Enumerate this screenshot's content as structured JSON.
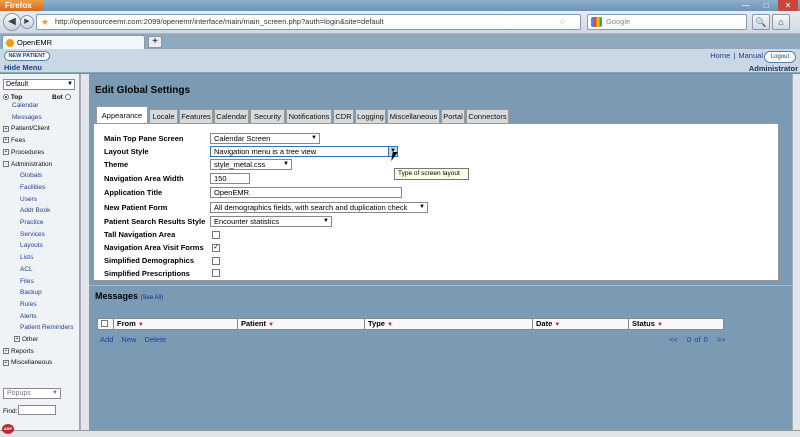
{
  "browser": {
    "app_name": "Firefox",
    "url": "http://opensourceemr.com:2099/openemr/interface/main/main_screen.php?auth=login&site=default",
    "search_placeholder": "Google",
    "tab_title": "OpenEMR",
    "new_tab": "+",
    "status_addon": "ABP"
  },
  "header": {
    "new_patient": "NEW PATIENT",
    "hide_menu": "Hide Menu",
    "home": "Home",
    "separator": "|",
    "manual": "Manual",
    "logout": "Logout",
    "user": "Administrator"
  },
  "sidebar": {
    "layout_select": "Default",
    "top_label": "Top",
    "bot_label": "Bot",
    "items": [
      {
        "label": "Calendar",
        "type": "sub"
      },
      {
        "label": "Messages",
        "type": "sub"
      },
      {
        "label": "Patient/Client",
        "type": "top"
      },
      {
        "label": "Fees",
        "type": "top"
      },
      {
        "label": "Procedures",
        "type": "top"
      },
      {
        "label": "Administration",
        "type": "top"
      },
      {
        "label": "Globals",
        "type": "sub2"
      },
      {
        "label": "Facilities",
        "type": "sub2"
      },
      {
        "label": "Users",
        "type": "sub2"
      },
      {
        "label": "Addr Book",
        "type": "sub2"
      },
      {
        "label": "Practice",
        "type": "sub2"
      },
      {
        "label": "Services",
        "type": "sub2"
      },
      {
        "label": "Layouts",
        "type": "sub2"
      },
      {
        "label": "Lists",
        "type": "sub2"
      },
      {
        "label": "ACL",
        "type": "sub2"
      },
      {
        "label": "Files",
        "type": "sub2"
      },
      {
        "label": "Backup",
        "type": "sub2"
      },
      {
        "label": "Rules",
        "type": "sub2"
      },
      {
        "label": "Alerts",
        "type": "sub2"
      },
      {
        "label": "Patient Reminders",
        "type": "sub2"
      },
      {
        "label": "Other",
        "type": "top2"
      },
      {
        "label": "Reports",
        "type": "top"
      },
      {
        "label": "Miscellaneous",
        "type": "top"
      }
    ],
    "popups": "Popups",
    "find_label": "Find:"
  },
  "main": {
    "title": "Edit Global Settings",
    "tabs": [
      "Appearance",
      "Locale",
      "Features",
      "Calendar",
      "Security",
      "Notifications",
      "CDR",
      "Logging",
      "Miscellaneous",
      "Portal",
      "Connectors"
    ],
    "settings": {
      "main_top_pane_label": "Main Top Pane Screen",
      "main_top_pane_value": "Calendar Screen",
      "layout_style_label": "Layout Style",
      "layout_style_value": "Navigation menu is a tree view",
      "theme_label": "Theme",
      "theme_value": "style_metal.css",
      "nav_width_label": "Navigation Area Width",
      "nav_width_value": "150",
      "app_title_label": "Application Title",
      "app_title_value": "OpenEMR",
      "new_patient_form_label": "New Patient Form",
      "new_patient_form_value": "All demographics fields, with search and duplication check",
      "search_results_style_label": "Patient Search Results Style",
      "search_results_style_value": "Encounter statistics",
      "tall_nav_label": "Tall Navigation Area",
      "nav_visit_forms_label": "Navigation Area Visit Forms",
      "simplified_demo_label": "Simplified Demographics",
      "simplified_rx_label": "Simplified Prescriptions"
    },
    "checked": {
      "tall_nav": false,
      "nav_visit_forms": true,
      "simplified_demo": false,
      "simplified_rx": false
    },
    "tooltip": "Type of screen layout"
  },
  "messages": {
    "title": "Messages",
    "see_all": "(See All)",
    "columns": [
      "From",
      "Patient",
      "Type",
      "Date",
      "Status"
    ],
    "add_new": "Add New",
    "delete": "Delete",
    "pager": "<<   0 of 0   >>"
  }
}
